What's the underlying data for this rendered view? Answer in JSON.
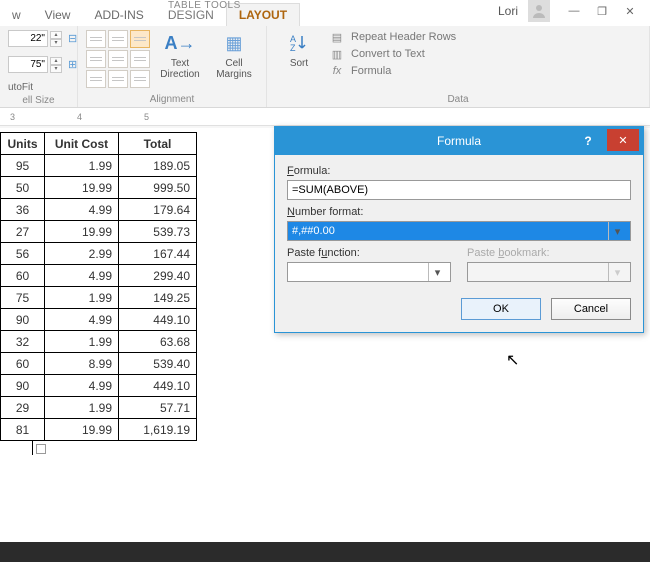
{
  "window": {
    "context_title": "TABLE TOOLS",
    "user": "Lori",
    "tabs": [
      {
        "label": "w"
      },
      {
        "label": "View"
      },
      {
        "label": "ADD-INS"
      },
      {
        "label": "DESIGN"
      },
      {
        "label": "LAYOUT"
      }
    ]
  },
  "ribbon": {
    "cell_size": {
      "height": "22\"",
      "width": "75\"",
      "autofit": "utoFit",
      "label": "ell Size"
    },
    "alignment": {
      "text_direction": "Text\nDirection",
      "cell_margins": "Cell\nMargins",
      "label": "Alignment"
    },
    "data": {
      "sort": "Sort",
      "repeat_header": "Repeat Header Rows",
      "convert": "Convert to Text",
      "formula": "Formula",
      "label": "Data"
    }
  },
  "ruler_marks": [
    "3",
    "4",
    "5"
  ],
  "table": {
    "headers": [
      "Units",
      "Unit Cost",
      "Total"
    ],
    "rows": [
      [
        "95",
        "1.99",
        "189.05"
      ],
      [
        "50",
        "19.99",
        "999.50"
      ],
      [
        "36",
        "4.99",
        "179.64"
      ],
      [
        "27",
        "19.99",
        "539.73"
      ],
      [
        "56",
        "2.99",
        "167.44"
      ],
      [
        "60",
        "4.99",
        "299.40"
      ],
      [
        "75",
        "1.99",
        "149.25"
      ],
      [
        "90",
        "4.99",
        "449.10"
      ],
      [
        "32",
        "1.99",
        "63.68"
      ],
      [
        "60",
        "8.99",
        "539.40"
      ],
      [
        "90",
        "4.99",
        "449.10"
      ],
      [
        "29",
        "1.99",
        "57.71"
      ],
      [
        "81",
        "19.99",
        "1,619.19"
      ]
    ]
  },
  "dialog": {
    "title": "Formula",
    "formula_label": "Formula:",
    "formula_value": "=SUM(ABOVE)",
    "numfmt_label": "Number format:",
    "numfmt_value": "#,##0.00",
    "paste_fn_label": "Paste function:",
    "paste_bm_label": "Paste bookmark:",
    "ok": "OK",
    "cancel": "Cancel"
  }
}
